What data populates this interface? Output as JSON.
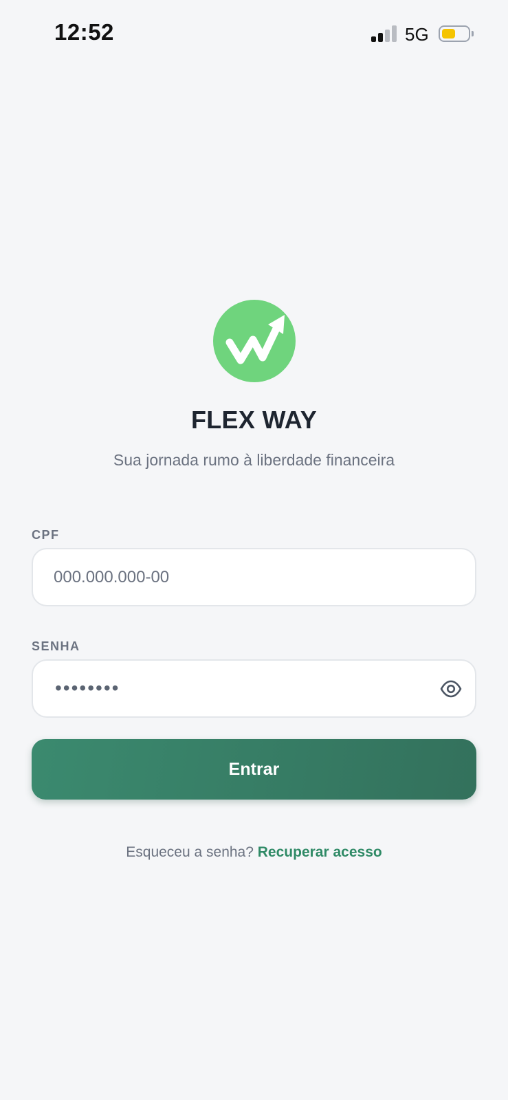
{
  "status_bar": {
    "time": "12:52",
    "network": "5G",
    "icons": [
      "signal-icon",
      "battery-icon"
    ]
  },
  "brand": {
    "name": "FLEX WAY",
    "tagline": "Sua jornada rumo à liberdade financeira",
    "logo_icon": "trend-arrow-w-icon",
    "logo_color": "#6fd47d"
  },
  "form": {
    "cpf": {
      "label": "CPF",
      "value": "",
      "placeholder": "000.000.000-00"
    },
    "password": {
      "label": "SENHA",
      "masked_value": "••••••••",
      "toggle_icon": "eye-icon"
    },
    "submit_label": "Entrar"
  },
  "footer": {
    "forgot_text": "Esqueceu a senha?",
    "recover_link": "Recuperar acesso"
  },
  "colors": {
    "background": "#f5f6f8",
    "primary": "#3b8a6f",
    "primary_dark": "#33715c",
    "link": "#2f8a66",
    "battery": "#f5c400"
  }
}
